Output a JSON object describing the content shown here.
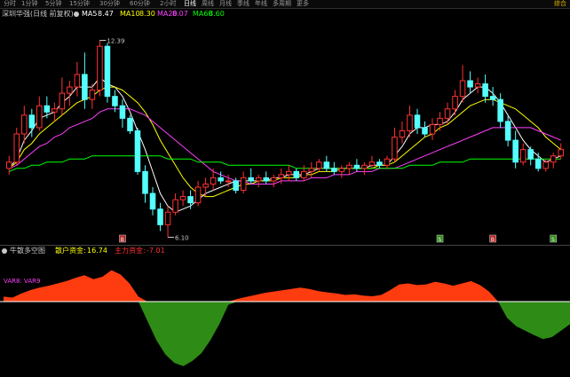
{
  "periods": [
    "分时",
    "1分钟",
    "5分钟",
    "15分钟",
    "30分钟",
    "60分钟",
    "2小时",
    "日线",
    "周线",
    "月线",
    "季线",
    "年线",
    "多周期",
    "更多"
  ],
  "active_period": "日线",
  "brand": "综合",
  "main_legend": {
    "title": "深圳华强(日线 前复权)",
    "ma5_label": "MA5",
    "ma5_value": "8.47",
    "ma10_label": "MA10",
    "ma10_value": "8.30",
    "ma20_label": "MA20",
    "ma20_value": "8.07",
    "ma60_label": "MA60",
    "ma60_value": "8.60"
  },
  "price_high_label": "12.39",
  "price_low_label": "6.10",
  "indicator_legend": {
    "title": "牛散多空图",
    "retail_label": "散户资金:",
    "retail_value": "16.74",
    "main_label": "主力资金:",
    "main_value": "-7.01"
  },
  "indicator_series_label": "VAR8: VAR9",
  "marker_labels": [
    "B",
    "S",
    "B",
    "S"
  ],
  "colors": {
    "up": "#ff3232",
    "down": "#54ffff",
    "ma5": "#ffffff",
    "ma10": "#ffff00",
    "ma20": "#ff40ff",
    "ma60": "#00ff00",
    "pos_area": "#ff3c0f",
    "neg_area": "#2e8b16",
    "text": "#c8c8c8"
  },
  "chart_data": {
    "type": "candlestick",
    "candles": [
      {
        "o": 8.3,
        "h": 8.7,
        "l": 8.1,
        "c": 8.5
      },
      {
        "o": 8.5,
        "h": 9.6,
        "l": 8.4,
        "c": 9.4
      },
      {
        "o": 9.4,
        "h": 10.3,
        "l": 9.1,
        "c": 10.0
      },
      {
        "o": 10.0,
        "h": 10.2,
        "l": 9.3,
        "c": 9.6
      },
      {
        "o": 9.6,
        "h": 10.6,
        "l": 9.5,
        "c": 10.3
      },
      {
        "o": 10.3,
        "h": 10.6,
        "l": 9.9,
        "c": 10.1
      },
      {
        "o": 10.1,
        "h": 10.4,
        "l": 9.8,
        "c": 10.2
      },
      {
        "o": 10.2,
        "h": 11.2,
        "l": 10.0,
        "c": 10.7
      },
      {
        "o": 10.7,
        "h": 11.1,
        "l": 10.3,
        "c": 10.9
      },
      {
        "o": 10.9,
        "h": 11.7,
        "l": 10.6,
        "c": 11.3
      },
      {
        "o": 11.3,
        "h": 12.0,
        "l": 10.2,
        "c": 10.5
      },
      {
        "o": 10.5,
        "h": 11.0,
        "l": 10.2,
        "c": 10.8
      },
      {
        "o": 10.8,
        "h": 12.39,
        "l": 10.6,
        "c": 12.2
      },
      {
        "o": 12.2,
        "h": 12.3,
        "l": 10.4,
        "c": 10.6
      },
      {
        "o": 10.6,
        "h": 10.8,
        "l": 10.1,
        "c": 10.3
      },
      {
        "o": 10.3,
        "h": 10.5,
        "l": 9.6,
        "c": 9.9
      },
      {
        "o": 9.9,
        "h": 10.0,
        "l": 9.4,
        "c": 9.5
      },
      {
        "o": 9.5,
        "h": 9.6,
        "l": 8.1,
        "c": 8.2
      },
      {
        "o": 8.2,
        "h": 8.4,
        "l": 7.2,
        "c": 7.5
      },
      {
        "o": 7.5,
        "h": 7.7,
        "l": 6.8,
        "c": 7.0
      },
      {
        "o": 7.0,
        "h": 7.2,
        "l": 6.3,
        "c": 6.5
      },
      {
        "o": 6.5,
        "h": 7.1,
        "l": 6.1,
        "c": 6.9
      },
      {
        "o": 6.9,
        "h": 7.5,
        "l": 6.8,
        "c": 7.3
      },
      {
        "o": 7.3,
        "h": 7.6,
        "l": 7.1,
        "c": 7.4
      },
      {
        "o": 7.4,
        "h": 7.6,
        "l": 7.0,
        "c": 7.2
      },
      {
        "o": 7.2,
        "h": 7.9,
        "l": 7.1,
        "c": 7.7
      },
      {
        "o": 7.7,
        "h": 8.0,
        "l": 7.4,
        "c": 7.8
      },
      {
        "o": 7.8,
        "h": 8.3,
        "l": 7.6,
        "c": 8.0
      },
      {
        "o": 8.0,
        "h": 8.2,
        "l": 7.8,
        "c": 7.9
      },
      {
        "o": 7.9,
        "h": 8.1,
        "l": 7.7,
        "c": 7.9
      },
      {
        "o": 7.9,
        "h": 8.0,
        "l": 7.5,
        "c": 7.6
      },
      {
        "o": 7.6,
        "h": 8.2,
        "l": 7.5,
        "c": 8.0
      },
      {
        "o": 8.0,
        "h": 8.3,
        "l": 7.8,
        "c": 7.9
      },
      {
        "o": 7.9,
        "h": 8.1,
        "l": 7.7,
        "c": 8.0
      },
      {
        "o": 8.0,
        "h": 8.2,
        "l": 7.8,
        "c": 7.9
      },
      {
        "o": 7.9,
        "h": 8.1,
        "l": 7.7,
        "c": 8.0
      },
      {
        "o": 8.0,
        "h": 8.3,
        "l": 7.8,
        "c": 8.1
      },
      {
        "o": 8.1,
        "h": 8.4,
        "l": 7.9,
        "c": 8.2
      },
      {
        "o": 8.2,
        "h": 8.3,
        "l": 7.9,
        "c": 8.0
      },
      {
        "o": 8.0,
        "h": 8.4,
        "l": 7.9,
        "c": 8.2
      },
      {
        "o": 8.2,
        "h": 8.5,
        "l": 8.0,
        "c": 8.3
      },
      {
        "o": 8.3,
        "h": 8.6,
        "l": 8.2,
        "c": 8.5
      },
      {
        "o": 8.5,
        "h": 8.7,
        "l": 8.2,
        "c": 8.3
      },
      {
        "o": 8.3,
        "h": 8.5,
        "l": 8.1,
        "c": 8.2
      },
      {
        "o": 8.2,
        "h": 8.4,
        "l": 8.0,
        "c": 8.3
      },
      {
        "o": 8.3,
        "h": 8.5,
        "l": 8.1,
        "c": 8.4
      },
      {
        "o": 8.4,
        "h": 8.6,
        "l": 8.2,
        "c": 8.3
      },
      {
        "o": 8.3,
        "h": 8.5,
        "l": 8.1,
        "c": 8.4
      },
      {
        "o": 8.4,
        "h": 8.7,
        "l": 8.3,
        "c": 8.5
      },
      {
        "o": 8.5,
        "h": 8.6,
        "l": 8.3,
        "c": 8.4
      },
      {
        "o": 8.4,
        "h": 8.7,
        "l": 8.3,
        "c": 8.6
      },
      {
        "o": 8.6,
        "h": 9.6,
        "l": 8.5,
        "c": 9.3
      },
      {
        "o": 9.3,
        "h": 9.8,
        "l": 9.1,
        "c": 9.5
      },
      {
        "o": 9.5,
        "h": 10.3,
        "l": 9.3,
        "c": 10.0
      },
      {
        "o": 10.0,
        "h": 10.2,
        "l": 9.4,
        "c": 9.6
      },
      {
        "o": 9.6,
        "h": 9.8,
        "l": 9.3,
        "c": 9.4
      },
      {
        "o": 9.4,
        "h": 9.9,
        "l": 9.2,
        "c": 9.7
      },
      {
        "o": 9.7,
        "h": 10.1,
        "l": 9.5,
        "c": 9.9
      },
      {
        "o": 9.9,
        "h": 10.4,
        "l": 9.7,
        "c": 10.2
      },
      {
        "o": 10.2,
        "h": 10.8,
        "l": 10.0,
        "c": 10.6
      },
      {
        "o": 10.6,
        "h": 11.6,
        "l": 10.4,
        "c": 11.1
      },
      {
        "o": 11.1,
        "h": 11.4,
        "l": 10.7,
        "c": 10.9
      },
      {
        "o": 10.9,
        "h": 11.2,
        "l": 10.7,
        "c": 11.0
      },
      {
        "o": 11.0,
        "h": 11.3,
        "l": 10.4,
        "c": 10.6
      },
      {
        "o": 10.6,
        "h": 10.9,
        "l": 10.3,
        "c": 10.5
      },
      {
        "o": 10.5,
        "h": 10.7,
        "l": 9.6,
        "c": 9.8
      },
      {
        "o": 9.8,
        "h": 10.0,
        "l": 9.0,
        "c": 9.2
      },
      {
        "o": 9.2,
        "h": 9.5,
        "l": 8.3,
        "c": 8.5
      },
      {
        "o": 8.5,
        "h": 9.1,
        "l": 8.4,
        "c": 8.9
      },
      {
        "o": 8.9,
        "h": 9.0,
        "l": 8.4,
        "c": 8.6
      },
      {
        "o": 8.6,
        "h": 8.8,
        "l": 8.2,
        "c": 8.3
      },
      {
        "o": 8.3,
        "h": 8.6,
        "l": 8.2,
        "c": 8.5
      },
      {
        "o": 8.5,
        "h": 8.8,
        "l": 8.3,
        "c": 8.7
      },
      {
        "o": 8.7,
        "h": 9.1,
        "l": 8.6,
        "c": 8.9
      }
    ],
    "ma_series": [
      {
        "name": "MA5",
        "values": [
          8.3,
          8.6,
          9.2,
          9.5,
          9.9,
          10.0,
          10.1,
          10.4,
          10.6,
          10.9,
          10.9,
          10.9,
          11.2,
          11.0,
          10.9,
          10.6,
          10.1,
          9.5,
          8.9,
          8.2,
          7.5,
          7.1,
          6.9,
          7.0,
          7.1,
          7.3,
          7.5,
          7.6,
          7.7,
          7.8,
          7.9,
          7.9,
          7.9,
          7.9,
          7.9,
          8.0,
          8.0,
          8.1,
          8.1,
          8.1,
          8.2,
          8.3,
          8.3,
          8.3,
          8.3,
          8.3,
          8.3,
          8.3,
          8.4,
          8.4,
          8.4,
          8.7,
          9.0,
          9.4,
          9.6,
          9.6,
          9.7,
          9.7,
          9.8,
          10.1,
          10.5,
          10.7,
          10.9,
          10.9,
          10.7,
          10.4,
          10.0,
          9.6,
          9.2,
          8.9,
          8.7,
          8.5,
          8.6,
          8.7
        ]
      },
      {
        "name": "MA10",
        "values": [
          8.3,
          8.5,
          8.9,
          9.1,
          9.4,
          9.6,
          9.8,
          10.0,
          10.2,
          10.4,
          10.5,
          10.6,
          10.8,
          10.9,
          10.9,
          10.8,
          10.6,
          10.4,
          10.1,
          9.7,
          9.2,
          8.8,
          8.4,
          8.0,
          7.7,
          7.5,
          7.4,
          7.4,
          7.5,
          7.6,
          7.7,
          7.8,
          7.8,
          7.9,
          7.9,
          7.9,
          8.0,
          8.0,
          8.0,
          8.1,
          8.1,
          8.2,
          8.2,
          8.2,
          8.3,
          8.3,
          8.3,
          8.3,
          8.3,
          8.4,
          8.4,
          8.5,
          8.7,
          8.9,
          9.1,
          9.3,
          9.4,
          9.6,
          9.7,
          9.9,
          10.1,
          10.3,
          10.4,
          10.5,
          10.5,
          10.4,
          10.3,
          10.2,
          10.0,
          9.8,
          9.6,
          9.3,
          9.1,
          8.9
        ]
      },
      {
        "name": "MA20",
        "values": [
          8.3,
          8.4,
          8.6,
          8.8,
          9.0,
          9.1,
          9.3,
          9.4,
          9.6,
          9.7,
          9.8,
          9.9,
          10.1,
          10.2,
          10.2,
          10.2,
          10.2,
          10.1,
          10.0,
          9.8,
          9.6,
          9.4,
          9.2,
          9.0,
          8.8,
          8.6,
          8.4,
          8.2,
          8.1,
          8.0,
          7.9,
          7.9,
          7.8,
          7.8,
          7.8,
          7.8,
          7.9,
          7.9,
          7.9,
          7.9,
          8.0,
          8.0,
          8.0,
          8.1,
          8.1,
          8.1,
          8.2,
          8.2,
          8.2,
          8.3,
          8.3,
          8.3,
          8.4,
          8.5,
          8.6,
          8.7,
          8.8,
          8.9,
          9.0,
          9.1,
          9.2,
          9.3,
          9.4,
          9.5,
          9.6,
          9.6,
          9.6,
          9.6,
          9.6,
          9.6,
          9.5,
          9.4,
          9.3,
          9.2
        ]
      },
      {
        "name": "MA60",
        "values": [
          8.2,
          8.3,
          8.3,
          8.4,
          8.4,
          8.5,
          8.5,
          8.5,
          8.6,
          8.6,
          8.6,
          8.7,
          8.7,
          8.7,
          8.7,
          8.7,
          8.7,
          8.7,
          8.7,
          8.7,
          8.7,
          8.6,
          8.6,
          8.6,
          8.6,
          8.5,
          8.5,
          8.5,
          8.5,
          8.4,
          8.4,
          8.4,
          8.4,
          8.4,
          8.4,
          8.4,
          8.4,
          8.4,
          8.3,
          8.3,
          8.3,
          8.3,
          8.3,
          8.3,
          8.3,
          8.3,
          8.3,
          8.3,
          8.3,
          8.3,
          8.3,
          8.3,
          8.3,
          8.4,
          8.4,
          8.4,
          8.4,
          8.5,
          8.5,
          8.5,
          8.5,
          8.6,
          8.6,
          8.6,
          8.6,
          8.6,
          8.6,
          8.6,
          8.6,
          8.6,
          8.6,
          8.6,
          8.6,
          8.6
        ]
      }
    ],
    "ylim": [
      6.0,
      12.8
    ],
    "indicator_values": [
      0.15,
      0.12,
      0.25,
      0.35,
      0.42,
      0.48,
      0.55,
      0.62,
      0.72,
      0.8,
      0.68,
      0.75,
      0.95,
      0.82,
      0.55,
      0.15,
      -0.3,
      -0.6,
      -0.82,
      -0.95,
      -1.0,
      -0.92,
      -0.8,
      -0.6,
      -0.35,
      -0.05,
      0.08,
      0.14,
      0.2,
      0.26,
      0.3,
      0.34,
      0.38,
      0.42,
      0.38,
      0.32,
      0.28,
      0.25,
      0.2,
      0.22,
      0.18,
      0.16,
      0.2,
      0.35,
      0.52,
      0.55,
      0.5,
      0.52,
      0.6,
      0.55,
      0.48,
      0.55,
      0.62,
      0.5,
      0.3,
      0.0,
      -0.25,
      -0.38,
      -0.45,
      -0.52,
      -0.58,
      -0.55,
      -0.45,
      -0.35
    ],
    "indicator_ylim": [
      -1.1,
      1.1
    ]
  }
}
